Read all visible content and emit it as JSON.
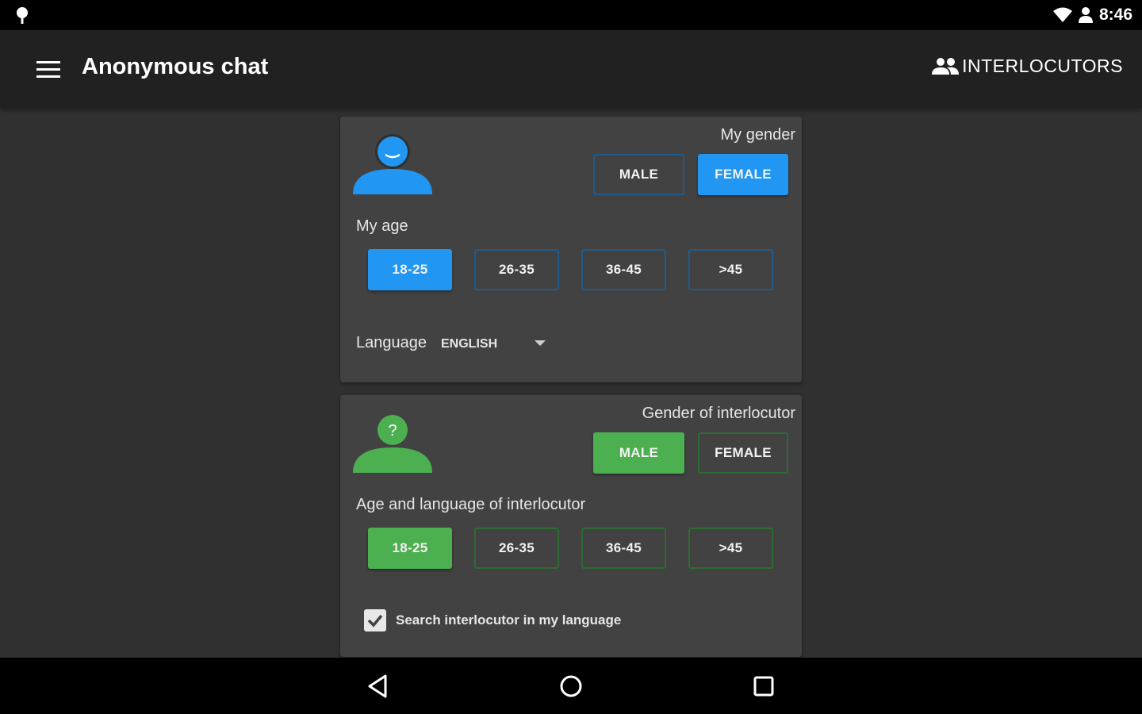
{
  "status_bar": {
    "time": "8:46",
    "icons": [
      "notification-icon",
      "wifi-icon",
      "account-icon"
    ]
  },
  "app_bar": {
    "title": "Anonymous chat",
    "action_label": "INTERLOCUTORS",
    "icons": [
      "menu-icon",
      "people-icon"
    ]
  },
  "my_profile": {
    "gender_label": "My gender",
    "gender_options": [
      "MALE",
      "FEMALE"
    ],
    "gender_selected": "FEMALE",
    "age_label": "My age",
    "age_options": [
      "18-25",
      "26-35",
      "36-45",
      ">45"
    ],
    "age_selected": "18-25",
    "language_label": "Language",
    "language_value": "ENGLISH",
    "accent_color": "#2196f3"
  },
  "interlocutor": {
    "gender_label": "Gender of interlocutor",
    "gender_options": [
      "MALE",
      "FEMALE"
    ],
    "gender_selected": "MALE",
    "age_label": "Age and language of interlocutor",
    "age_options": [
      "18-25",
      "26-35",
      "36-45",
      ">45"
    ],
    "age_selected": "18-25",
    "same_language_label": "Search interlocutor in my language",
    "same_language_checked": true,
    "accent_color": "#4caf50"
  },
  "nav_bar": {
    "icons": [
      "back-icon",
      "home-icon",
      "recents-icon"
    ]
  }
}
